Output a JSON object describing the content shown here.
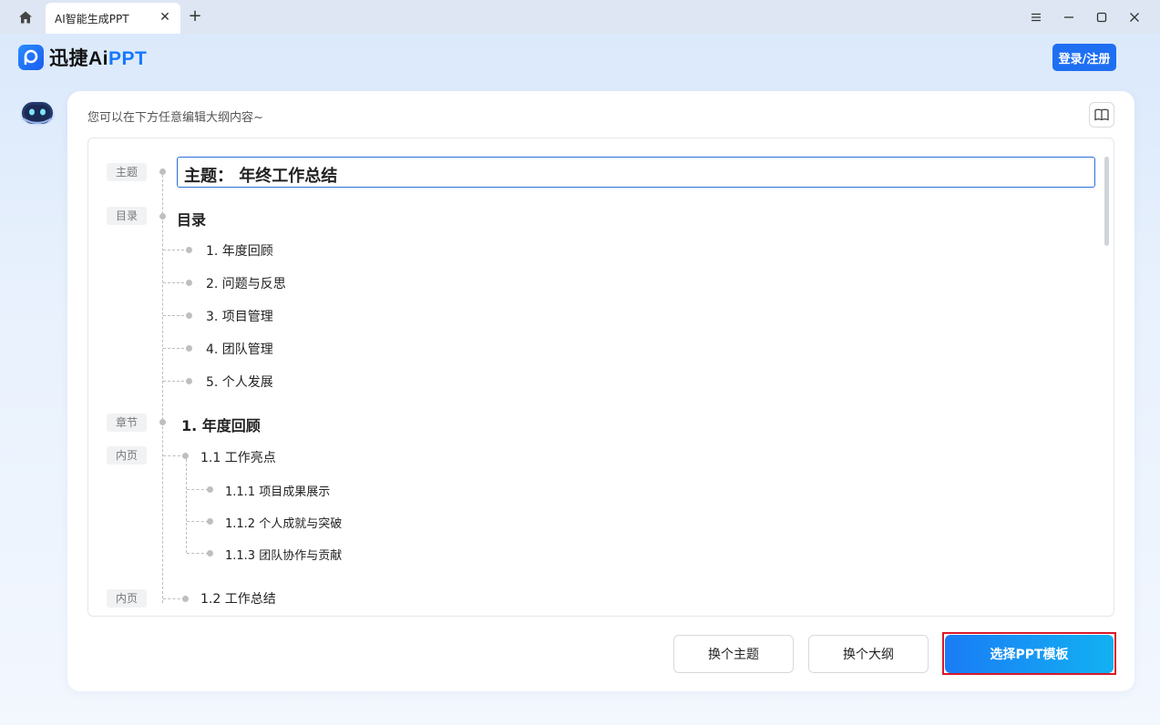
{
  "titlebar": {
    "tab_title": "AI智能生成PPT",
    "tab_close": "✕",
    "tab_add": "+"
  },
  "header": {
    "brand_name": "迅捷Ai",
    "brand_ppt": "PPT",
    "login_label": "登录/注册"
  },
  "card": {
    "hint": "您可以在下方任意编辑大纲内容~"
  },
  "outline": {
    "tags": {
      "topic": "主题",
      "toc": "目录",
      "chapter": "章节",
      "page": "内页",
      "page2": "内页"
    },
    "topic": "主题： 年终工作总结",
    "toc_title": "目录",
    "toc_items": [
      "1. 年度回顾",
      "2. 问题与反思",
      "3. 项目管理",
      "4. 团队管理",
      "5. 个人发展"
    ],
    "chapter": "1. 年度回顾",
    "page1": "1.1 工作亮点",
    "page1_subs": [
      "1.1.1 项目成果展示",
      "1.1.2 个人成就与突破",
      "1.1.3 团队协作与贡献"
    ],
    "page2": "1.2 工作总结"
  },
  "footer": {
    "change_theme": "换个主题",
    "change_outline": "换个大纲",
    "select_template": "选择PPT模板"
  },
  "colors": {
    "accent": "#1f6ff2",
    "highlight_border": "#d8192a"
  }
}
